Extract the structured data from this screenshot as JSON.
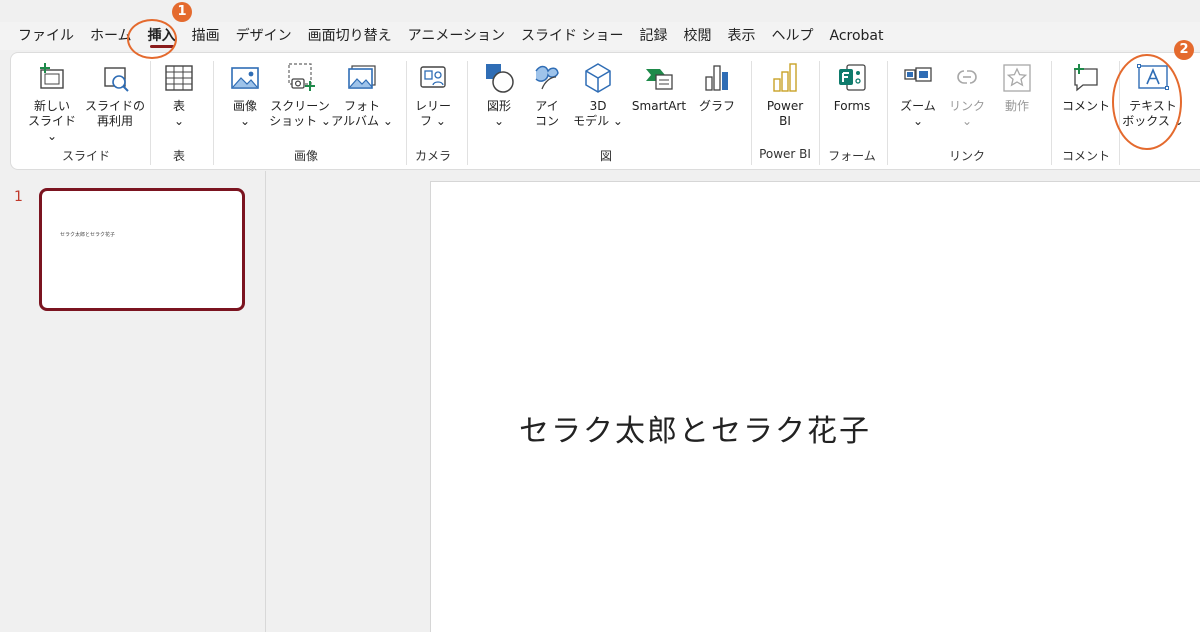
{
  "tabs": [
    {
      "label": "ファイル"
    },
    {
      "label": "ホーム"
    },
    {
      "label": "挿入"
    },
    {
      "label": "描画"
    },
    {
      "label": "デザイン"
    },
    {
      "label": "画面切り替え"
    },
    {
      "label": "アニメーション"
    },
    {
      "label": "スライド ショー"
    },
    {
      "label": "記録"
    },
    {
      "label": "校閲"
    },
    {
      "label": "表示"
    },
    {
      "label": "ヘルプ"
    },
    {
      "label": "Acrobat"
    }
  ],
  "ribbon": {
    "buttons": {
      "new_slide": "新しい\nスライド ⌄",
      "reuse_slide": "スライドの\n再利用",
      "table": "表\n⌄",
      "images": "画像\n⌄",
      "screenshot": "スクリーン\nショット ⌄",
      "photo_album": "フォト\nアルバム ⌄",
      "cameo": "レリー\nフ ⌄",
      "shapes": "図形\n⌄",
      "icons": "アイ\nコン",
      "models_3d": "3D\nモデル ⌄",
      "smartart": "SmartArt",
      "chart": "グラフ",
      "power_bi": "Power\nBI",
      "forms": "Forms",
      "zoom": "ズーム\n⌄",
      "link": "リンク\n⌄",
      "action": "動作",
      "comment": "コメント",
      "textbox": "テキスト\nボックス ⌄"
    },
    "groups": {
      "slides": "スライド",
      "tables": "表",
      "images": "画像",
      "camera": "カメラ",
      "illustrations": "図",
      "power_bi": "Power BI",
      "forms": "フォーム",
      "links": "リンク",
      "comments": "コメント"
    }
  },
  "thumbnail": {
    "number": "1",
    "text": "セラク太郎とセラク花子"
  },
  "slide": {
    "text": "セラク太郎とセラク花子"
  },
  "annotations": {
    "badge1": "1",
    "badge2": "2"
  },
  "colors": {
    "accent": "#e46a2e",
    "selected_border": "#7b1420",
    "icon_blue": "#2f6db5",
    "icon_green": "#1e8a4a"
  }
}
